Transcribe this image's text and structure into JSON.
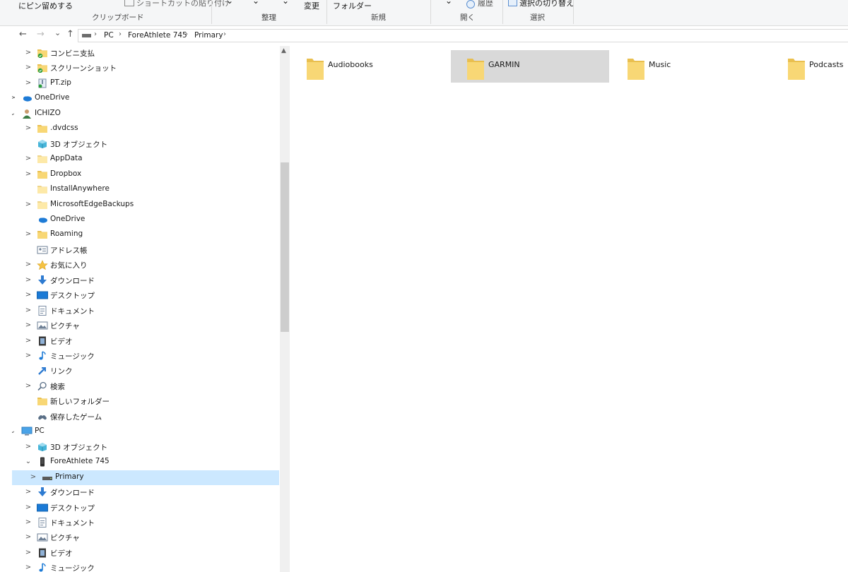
{
  "ribbon": {
    "pin_label": "にピン留めする",
    "shortcut_label": "ショートカットの貼り付け",
    "change_label": "変更",
    "folder_label": "フォルダー",
    "history_label": "履歴",
    "toggle_select_label": "選択の切り替え",
    "groups": {
      "clipboard": "クリップボード",
      "organize": "整理",
      "new": "新規",
      "open": "開く",
      "select": "選択"
    }
  },
  "address": {
    "back": "←",
    "forward": "→",
    "recent": "⌄",
    "up": "↑",
    "crumbs": [
      "PC",
      "ForeAthlete 745",
      "Primary"
    ]
  },
  "tree": [
    {
      "label": "コンビニ支払",
      "icon": "folder-sync-icon",
      "chevron": ">"
    },
    {
      "label": "スクリーンショット",
      "icon": "folder-sync-icon",
      "chevron": ">"
    },
    {
      "label": "PT.zip",
      "icon": "zip-icon",
      "chevron": ">"
    },
    {
      "label": "OneDrive",
      "icon": "cloud-icon",
      "chevron": ">"
    },
    {
      "label": "ICHIZO",
      "icon": "user-icon",
      "chevron": "⌄"
    },
    {
      "label": ".dvdcss",
      "icon": "folder-icon",
      "chevron": ">"
    },
    {
      "label": "3D オブジェクト",
      "icon": "cube-icon",
      "chevron": ""
    },
    {
      "label": "AppData",
      "icon": "folder-light-icon",
      "chevron": ">"
    },
    {
      "label": "Dropbox",
      "icon": "folder-icon",
      "chevron": ">"
    },
    {
      "label": "InstallAnywhere",
      "icon": "folder-light-icon",
      "chevron": ""
    },
    {
      "label": "MicrosoftEdgeBackups",
      "icon": "folder-light-icon",
      "chevron": ">"
    },
    {
      "label": "OneDrive",
      "icon": "cloud-icon",
      "chevron": ""
    },
    {
      "label": "Roaming",
      "icon": "folder-icon",
      "chevron": ">"
    },
    {
      "label": "アドレス帳",
      "icon": "contacts-icon",
      "chevron": ""
    },
    {
      "label": "お気に入り",
      "icon": "star-icon",
      "chevron": ">"
    },
    {
      "label": "ダウンロード",
      "icon": "download-icon",
      "chevron": ">"
    },
    {
      "label": "デスクトップ",
      "icon": "desktop-icon",
      "chevron": ">"
    },
    {
      "label": "ドキュメント",
      "icon": "document-icon",
      "chevron": ">"
    },
    {
      "label": "ピクチャ",
      "icon": "pictures-icon",
      "chevron": ">"
    },
    {
      "label": "ビデオ",
      "icon": "video-icon",
      "chevron": ">"
    },
    {
      "label": "ミュージック",
      "icon": "music-icon",
      "chevron": ">"
    },
    {
      "label": "リンク",
      "icon": "link-icon",
      "chevron": ""
    },
    {
      "label": "検索",
      "icon": "search-icon",
      "chevron": ">"
    },
    {
      "label": "新しいフォルダー",
      "icon": "folder-icon",
      "chevron": ""
    },
    {
      "label": "保存したゲーム",
      "icon": "games-icon",
      "chevron": ""
    },
    {
      "label": "PC",
      "icon": "pc-icon",
      "chevron": "⌄"
    },
    {
      "label": "3D オブジェクト",
      "icon": "cube-icon",
      "chevron": ">"
    },
    {
      "label": "ForeAthlete 745",
      "icon": "device-icon",
      "chevron": "⌄"
    },
    {
      "label": "Primary",
      "icon": "drive-icon",
      "chevron": ">"
    },
    {
      "label": "ダウンロード",
      "icon": "download-icon",
      "chevron": ">"
    },
    {
      "label": "デスクトップ",
      "icon": "desktop-icon",
      "chevron": ">"
    },
    {
      "label": "ドキュメント",
      "icon": "document-icon",
      "chevron": ">"
    },
    {
      "label": "ピクチャ",
      "icon": "pictures-icon",
      "chevron": ">"
    },
    {
      "label": "ビデオ",
      "icon": "video-icon",
      "chevron": ">"
    },
    {
      "label": "ミュージック",
      "icon": "music-icon",
      "chevron": ">"
    }
  ],
  "selected_tree_item": "Primary",
  "folders": [
    "Audiobooks",
    "GARMIN",
    "Music",
    "Podcasts"
  ],
  "highlighted_folder": "GARMIN",
  "colors": {
    "selection": "#cce8ff",
    "hover": "#d9d9d9",
    "folder": "#f8d775",
    "accent": "#1e7bd6"
  }
}
